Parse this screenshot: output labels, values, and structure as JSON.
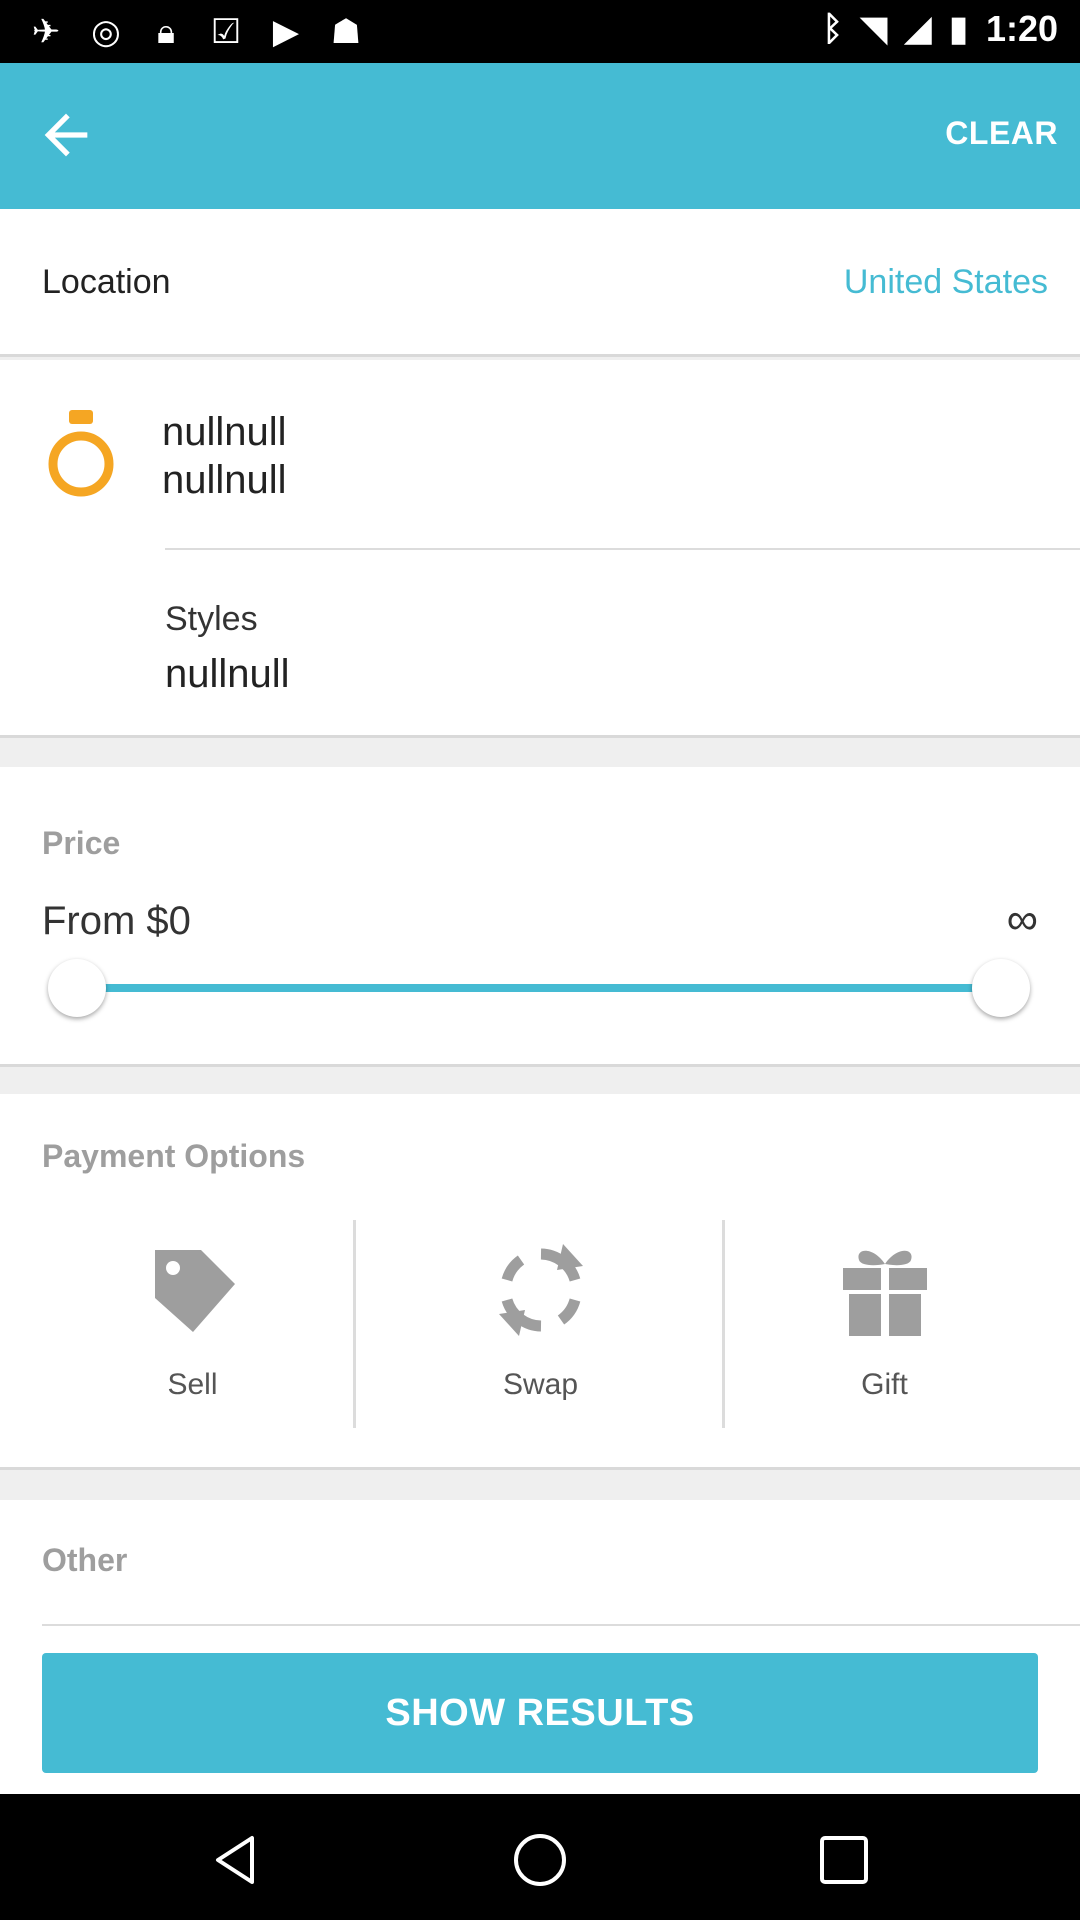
{
  "status_bar": {
    "time": "1:20",
    "left_icons": [
      "satellite-icon",
      "sync-icon",
      "lock-icon",
      "task-icon",
      "play-icon",
      "android-icon"
    ],
    "right_icons": [
      "bluetooth-icon",
      "wifi-icon",
      "signal-icon",
      "battery-icon"
    ]
  },
  "app_bar": {
    "back_icon": "arrow-left-icon",
    "clear_label": "CLEAR"
  },
  "location": {
    "label": "Location",
    "value": "United States"
  },
  "category": {
    "icon": "ring-icon",
    "name_line1": "nullnull",
    "name_line2": "nullnull",
    "styles_label": "Styles",
    "styles_value": "nullnull"
  },
  "price": {
    "heading": "Price",
    "from_label": "From $0",
    "to_label": "∞",
    "range_min_fraction": 0.0,
    "range_max_fraction": 1.0
  },
  "payment": {
    "heading": "Payment Options",
    "options": [
      {
        "label": "Sell",
        "icon": "tag-icon"
      },
      {
        "label": "Swap",
        "icon": "swap-icon"
      },
      {
        "label": "Gift",
        "icon": "gift-icon"
      }
    ]
  },
  "other": {
    "heading": "Other"
  },
  "show_results_label": "SHOW RESULTS",
  "colors": {
    "accent": "#45bbd3",
    "ring": "#f5a623",
    "icon_gray": "#9e9e9e"
  }
}
